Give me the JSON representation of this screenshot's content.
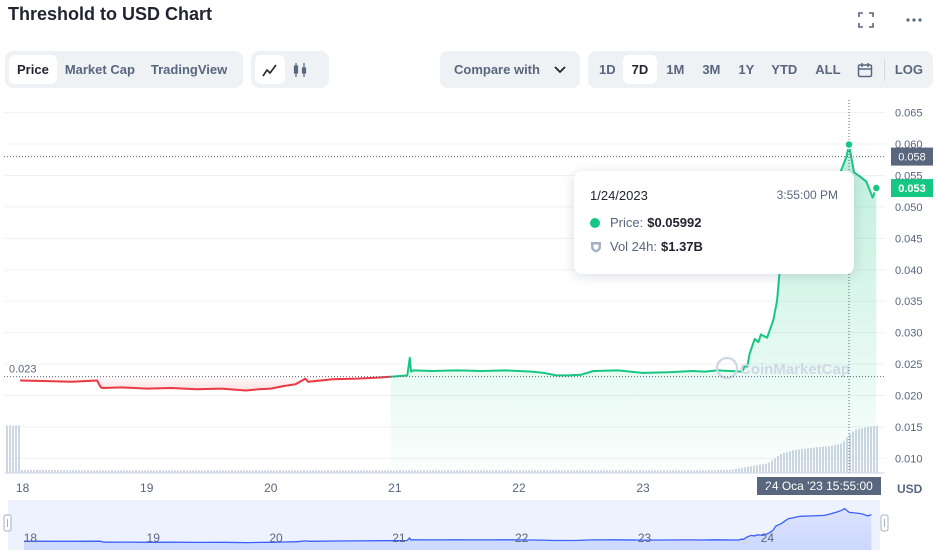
{
  "title": "Threshold to USD Chart",
  "icons": {
    "fullscreen": "fullscreen-icon",
    "more": "more-icon",
    "line": "line-chart-icon",
    "candle": "candlestick-icon",
    "calendar": "calendar-icon",
    "chevron": "chevron-down-icon",
    "vol": "shield-icon"
  },
  "tabs": [
    "Price",
    "Market Cap",
    "TradingView"
  ],
  "compare_label": "Compare with",
  "ranges": [
    "1D",
    "7D",
    "1M",
    "3M",
    "1Y",
    "YTD",
    "ALL"
  ],
  "log_label": "LOG",
  "tooltip": {
    "date": "1/24/2023",
    "time": "3:55:00 PM",
    "price_label": "Price:",
    "price_value": "$0.05992",
    "vol_label": "Vol 24h:",
    "vol_value": "$1.37B"
  },
  "watermark": "CoinMarketCap",
  "colors": {
    "up": "#16c784",
    "down": "#ea3943",
    "axis_text": "#58667e",
    "grid": "#eff2f5",
    "crosshair_label_bg": "#58667e",
    "nav_line": "#3861fb"
  },
  "chart_data": {
    "type": "line",
    "title": "Threshold to USD Chart",
    "currency": "USD",
    "selected_range": "7D",
    "x_ticks": [
      "18",
      "19",
      "20",
      "21",
      "22",
      "23",
      "24"
    ],
    "y_ticks": [
      "0.065",
      "0.060",
      "0.055",
      "0.050",
      "0.045",
      "0.040",
      "0.035",
      "0.030",
      "0.025",
      "0.020",
      "0.015",
      "0.010"
    ],
    "ylim": [
      0.008,
      0.067
    ],
    "baseline_value": 0.023,
    "baseline_label": "0.023",
    "current_price_label": "0.053",
    "crosshair_price_label": "0.058",
    "crosshair_time_label": "24 Oca '23   15:55:00",
    "hover_point": {
      "x": 24.66,
      "y": 0.05992
    },
    "series": [
      {
        "x": [
          17.98,
          18.2,
          18.4,
          18.6,
          18.63,
          18.65,
          18.8,
          19.0,
          19.2,
          19.4,
          19.6,
          19.8,
          19.9,
          20.0,
          20.1,
          20.2,
          20.28,
          20.3,
          20.4,
          20.5,
          20.7,
          20.9,
          21.1,
          21.12,
          21.13,
          21.15,
          21.3,
          21.5,
          21.7,
          21.9,
          22.1,
          22.2,
          22.3,
          22.4,
          22.5,
          22.6,
          22.8,
          23.0,
          23.2,
          23.4,
          23.5,
          23.6,
          23.8,
          23.82,
          23.84,
          23.86,
          23.9,
          23.93,
          23.95,
          24.0,
          24.05,
          24.08,
          24.1,
          24.15,
          24.2,
          24.3,
          24.4,
          24.5,
          24.55,
          24.6,
          24.64,
          24.66,
          24.7,
          24.75,
          24.8,
          24.85,
          24.88
        ],
        "y": [
          0.0224,
          0.0223,
          0.0222,
          0.0224,
          0.0213,
          0.0212,
          0.0213,
          0.0211,
          0.0212,
          0.021,
          0.0211,
          0.0208,
          0.021,
          0.0211,
          0.0215,
          0.0218,
          0.0227,
          0.0222,
          0.0224,
          0.0226,
          0.0227,
          0.0229,
          0.0232,
          0.026,
          0.0238,
          0.024,
          0.0239,
          0.024,
          0.0239,
          0.024,
          0.0238,
          0.0236,
          0.0232,
          0.0232,
          0.0233,
          0.0239,
          0.024,
          0.0236,
          0.0237,
          0.0239,
          0.0238,
          0.024,
          0.0238,
          0.0247,
          0.0246,
          0.0267,
          0.029,
          0.0285,
          0.0297,
          0.0292,
          0.032,
          0.035,
          0.0395,
          0.043,
          0.048,
          0.051,
          0.0515,
          0.052,
          0.054,
          0.056,
          0.058,
          0.0599,
          0.0555,
          0.0548,
          0.054,
          0.0515,
          0.053
        ]
      }
    ],
    "volume_series": {
      "x": [
        17.98,
        18.5,
        19.0,
        19.5,
        20.0,
        20.5,
        21.0,
        21.5,
        22.0,
        22.5,
        23.0,
        23.5,
        23.7,
        23.85,
        24.0,
        24.1,
        24.2,
        24.3,
        24.4,
        24.5,
        24.6,
        24.65,
        24.7,
        24.8,
        24.88
      ],
      "relative": [
        0.06,
        0.05,
        0.05,
        0.05,
        0.05,
        0.05,
        0.05,
        0.05,
        0.05,
        0.05,
        0.05,
        0.05,
        0.06,
        0.12,
        0.18,
        0.35,
        0.42,
        0.45,
        0.48,
        0.5,
        0.55,
        0.7,
        0.8,
        0.85,
        0.88
      ]
    },
    "navigator_ticks": [
      "18",
      "19",
      "20",
      "21",
      "22",
      "23",
      "24"
    ]
  }
}
